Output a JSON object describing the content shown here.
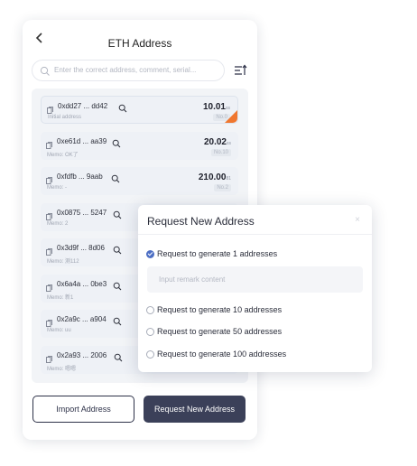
{
  "header": {
    "title": "ETH Address",
    "back_icon": "chevron-left-icon"
  },
  "search": {
    "placeholder": "Enter the correct address, comment, serial...",
    "icon": "search-icon",
    "sort_icon": "sort-icon"
  },
  "items": [
    {
      "address": "0xdd27 ... dd42",
      "memo": "Initial address",
      "amount": "10.01",
      "unit": "ss",
      "no": "No.0",
      "flag": true
    },
    {
      "address": "0xe61d ... aa39",
      "memo": "Memo: OK了",
      "amount": "20.02",
      "unit": "ss",
      "no": "No.10",
      "flag": false
    },
    {
      "address": "0xfdfb ... 9aab",
      "memo": "Memo: -",
      "amount": "210.00",
      "unit": "81",
      "no": "No.2",
      "flag": false
    },
    {
      "address": "0x0875 ... 5247",
      "memo": "Memo: 2",
      "amount": "",
      "unit": "",
      "no": "",
      "flag": false
    },
    {
      "address": "0x3d9f ... 8d06",
      "memo": "Memo: 测112",
      "amount": "",
      "unit": "",
      "no": "",
      "flag": false
    },
    {
      "address": "0x6a4a ... 0be3",
      "memo": "Memo: 新1",
      "amount": "",
      "unit": "",
      "no": "",
      "flag": false
    },
    {
      "address": "0x2a9c ... a904",
      "memo": "Memo: uu",
      "amount": "",
      "unit": "",
      "no": "",
      "flag": false
    },
    {
      "address": "0x2a93 ... 2006",
      "memo": "Memo: 嗯嗯",
      "amount": "",
      "unit": "",
      "no": "",
      "flag": false
    }
  ],
  "footer": {
    "import_label": "Import Address",
    "request_label": "Request New Address"
  },
  "modal": {
    "title": "Request New Address",
    "close_label": "×",
    "remark_placeholder": "Input remark content",
    "options": [
      {
        "label": "Request to generate 1 addresses",
        "selected": true
      },
      {
        "label": "Request to generate 10 addresses",
        "selected": false
      },
      {
        "label": "Request to generate 50 addresses",
        "selected": false
      },
      {
        "label": "Request to generate 100 addresses",
        "selected": false
      }
    ]
  },
  "colors": {
    "accent": "#3b4059",
    "radio_selected": "#4d6fc4",
    "flag": "#f0772f",
    "list_bg": "#f2f4f7"
  }
}
